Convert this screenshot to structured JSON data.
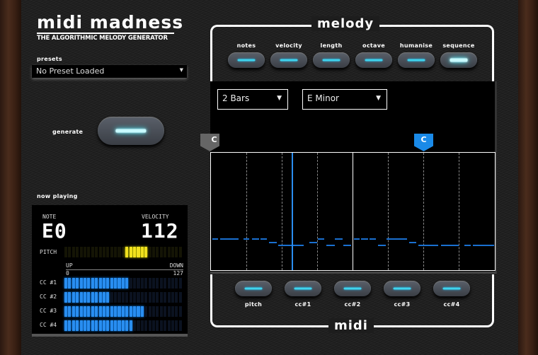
{
  "header": {
    "title": "midi madness",
    "subtitle": "The Algorithmic Melody Generator"
  },
  "presets": {
    "label": "presets",
    "value": "No Preset Loaded"
  },
  "generate": {
    "label": "Generate",
    "active": true
  },
  "now_playing": {
    "label": "now playing",
    "note_label": "NOTE",
    "note": "E0",
    "velocity_label": "VELOCITY",
    "velocity": "112",
    "pitch_label": "PITCH",
    "pitch_lit_from": 16,
    "pitch_lit_to": 22,
    "segments": 31,
    "up_label": "UP",
    "down_label": "DOWN",
    "min": "0",
    "max": "127",
    "cc": [
      {
        "label": "CC #1",
        "segments_lit": 17
      },
      {
        "label": "CC #2",
        "segments_lit": 12
      },
      {
        "label": "CC #3",
        "segments_lit": 21
      },
      {
        "label": "CC #4",
        "segments_lit": 18
      }
    ]
  },
  "melody": {
    "title": "melody",
    "buttons": [
      {
        "label": "notes",
        "active": false
      },
      {
        "label": "velocity",
        "active": false
      },
      {
        "label": "length",
        "active": false
      },
      {
        "label": "octave",
        "active": false
      },
      {
        "label": "humanise",
        "active": false
      },
      {
        "label": "sequence",
        "active": true
      }
    ]
  },
  "sequencer": {
    "bars": "2 Bars",
    "scale": "E Minor",
    "start_marker": "C",
    "loop_marker": "C",
    "playhead_beat": 2.27,
    "notes_color": "#1a70d0",
    "notes": [
      [
        0,
        0.03,
        0.2
      ],
      [
        0,
        0.26,
        0.77
      ],
      [
        0,
        0.91,
        1.08
      ],
      [
        0,
        1.16,
        1.36
      ],
      [
        0,
        1.39,
        1.57
      ],
      [
        0,
        3.01,
        3.19
      ],
      [
        0,
        3.5,
        3.72
      ],
      [
        0,
        4.04,
        4.2
      ],
      [
        0,
        4.24,
        4.43
      ],
      [
        0,
        4.47,
        4.66
      ],
      [
        0,
        4.95,
        5.54
      ],
      [
        1,
        1.64,
        1.86
      ],
      [
        1,
        2.77,
        2.99
      ],
      [
        1,
        5.6,
        5.8
      ],
      [
        2,
        1.89,
        2.11
      ],
      [
        2,
        2.12,
        2.62
      ],
      [
        2,
        3.26,
        3.49
      ],
      [
        2,
        3.74,
        3.95
      ],
      [
        2,
        4.72,
        4.94
      ],
      [
        2,
        5.85,
        6.42
      ],
      [
        2,
        6.5,
        6.99
      ],
      [
        2,
        7.15,
        7.34
      ],
      [
        2,
        7.39,
        8.0
      ]
    ]
  },
  "midi": {
    "title": "midi",
    "buttons": [
      {
        "label": "pitch"
      },
      {
        "label": "cc#1"
      },
      {
        "label": "cc#2"
      },
      {
        "label": "cc#3"
      },
      {
        "label": "cc#4"
      }
    ]
  }
}
